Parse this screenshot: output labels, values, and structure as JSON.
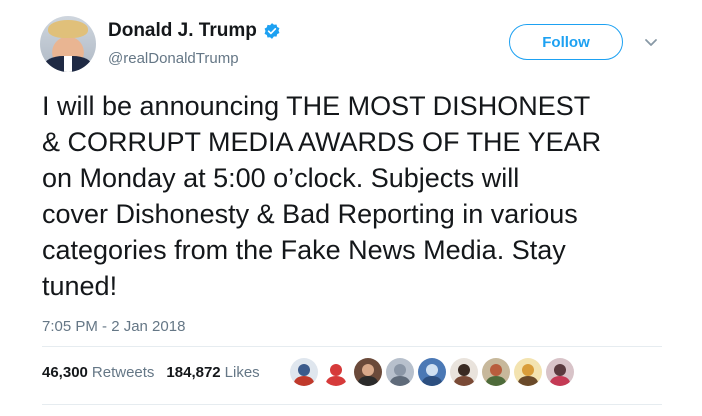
{
  "author": {
    "display_name": "Donald J. Trump",
    "handle": "@realDonaldTrump",
    "verified": true,
    "avatar_icon": "avatar-photo"
  },
  "follow_label": "Follow",
  "tweet_text": "I will be announcing THE MOST DISHONEST\n& CORRUPT MEDIA AWARDS OF THE YEAR\non Monday at 5:00 o’clock. Subjects will\ncover Dishonesty & Bad Reporting in various\ncategories from the Fake News Media. Stay\ntuned!",
  "timestamp": "7:05 PM - 2 Jan 2018",
  "stats": {
    "retweets_count": "46,300",
    "retweets_label": "Retweets",
    "likes_count": "184,872",
    "likes_label": "Likes"
  },
  "likers": [
    {
      "bg": "#dfe6ee",
      "head": "#3b5b8c",
      "body": "#c0392b"
    },
    {
      "bg": "#ffffff",
      "head": "#d63a3a",
      "body": "#d63a3a"
    },
    {
      "bg": "#6b4a3a",
      "head": "#d9a98a",
      "body": "#2b2b2b"
    },
    {
      "bg": "#b7c0cc",
      "head": "#8a96a6",
      "body": "#5f6b7a"
    },
    {
      "bg": "#4a78b5",
      "head": "#cfe0f2",
      "body": "#2c4f80"
    },
    {
      "bg": "#e9e3dc",
      "head": "#3a2a22",
      "body": "#7a4a36"
    },
    {
      "bg": "#c7b89b",
      "head": "#b85d3d",
      "body": "#4e6b3a"
    },
    {
      "bg": "#f3e3b0",
      "head": "#d99d3a",
      "body": "#6a4a2a"
    },
    {
      "bg": "#d8c3c8",
      "head": "#5a3a3e",
      "body": "#c43a55"
    }
  ],
  "colors": {
    "accent": "#1da1f2",
    "text": "#14171a",
    "secondary_text": "#657786",
    "divider": "#e6ecf0"
  }
}
